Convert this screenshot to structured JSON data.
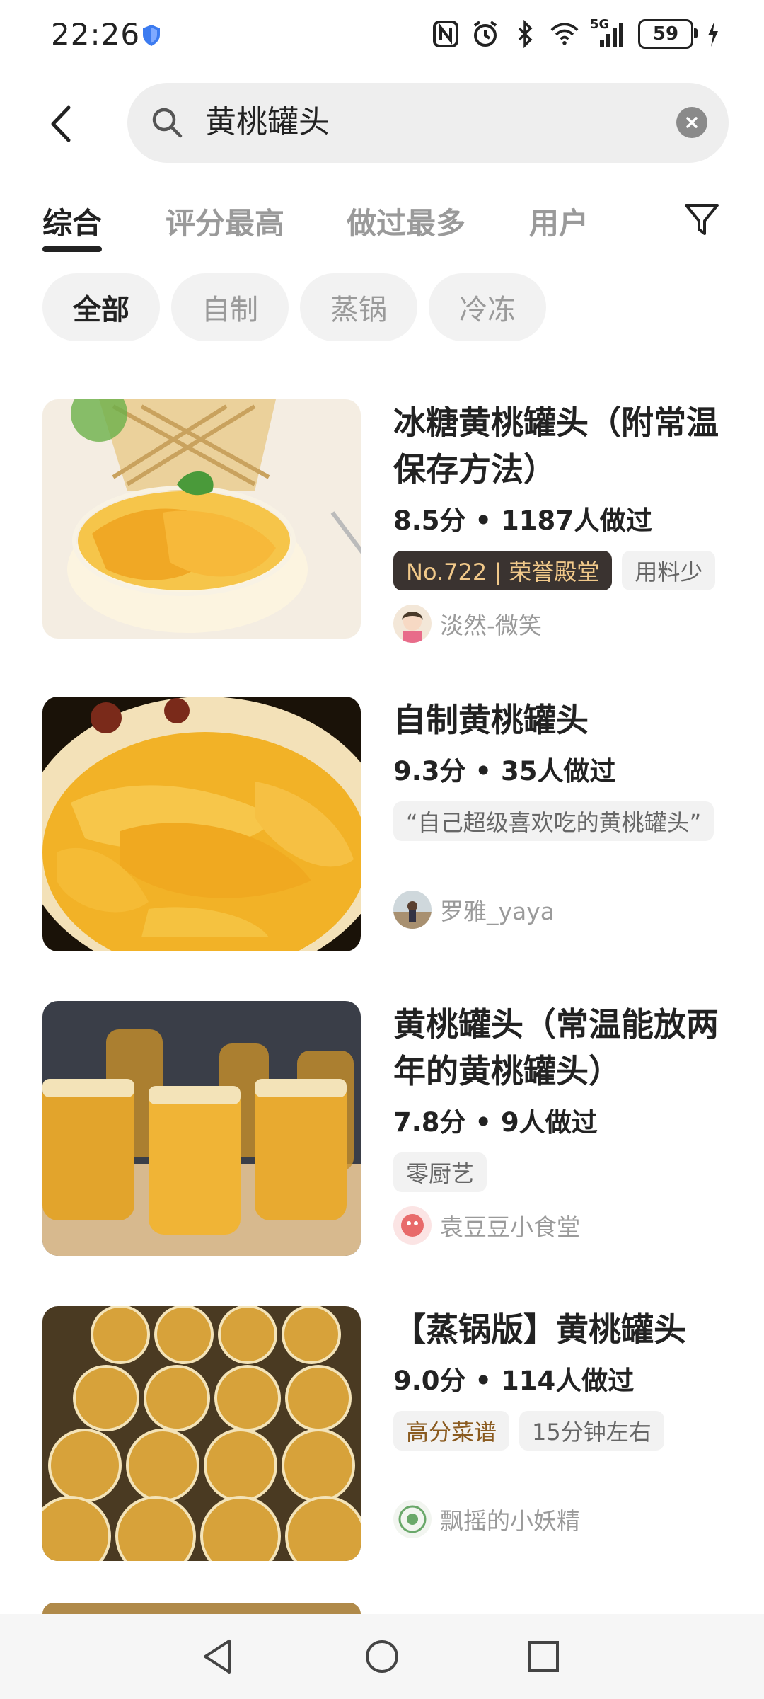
{
  "status_bar": {
    "time": "22:26",
    "battery": "59",
    "network": "5G",
    "icons": [
      "shield-icon",
      "nfc-icon",
      "alarm-icon",
      "bluetooth-icon",
      "wifi-icon",
      "signal-icon",
      "battery-icon",
      "charging-icon"
    ]
  },
  "search": {
    "query": "黄桃罐头"
  },
  "tabs": [
    {
      "label": "综合"
    },
    {
      "label": "评分最高"
    },
    {
      "label": "做过最多"
    },
    {
      "label": "用户"
    }
  ],
  "chips": [
    {
      "label": "全部"
    },
    {
      "label": "自制"
    },
    {
      "label": "蒸锅"
    },
    {
      "label": "冷冻"
    }
  ],
  "recipes": [
    {
      "title": "冰糖黄桃罐头（附常温保存方法）",
      "meta": "8.5分 • 1187人做过",
      "tags": [
        "No.722 | 荣誉殿堂",
        "用料少"
      ],
      "author": "淡然-微笑"
    },
    {
      "title": "自制黄桃罐头",
      "meta": "9.3分 • 35人做过",
      "tags": [
        "“自己超级喜欢吃的黄桃罐头”"
      ],
      "author": "罗雅_yaya"
    },
    {
      "title": "黄桃罐头（常温能放两年的黄桃罐头）",
      "meta": "7.8分 • 9人做过",
      "tags": [
        "零厨艺"
      ],
      "author": "袁豆豆小食堂"
    },
    {
      "title": "【蒸锅版】黄桃罐头",
      "meta": "9.0分 • 114人做过",
      "tags": [
        "高分菜谱",
        "15分钟左右"
      ],
      "author": "飘摇的小妖精"
    }
  ],
  "colors": {
    "honor_tag_bg": "#3a3330",
    "honor_tag_text": "#f1c98a",
    "gold_tag_text": "#8a5a1f",
    "peach": "#f2b230"
  }
}
